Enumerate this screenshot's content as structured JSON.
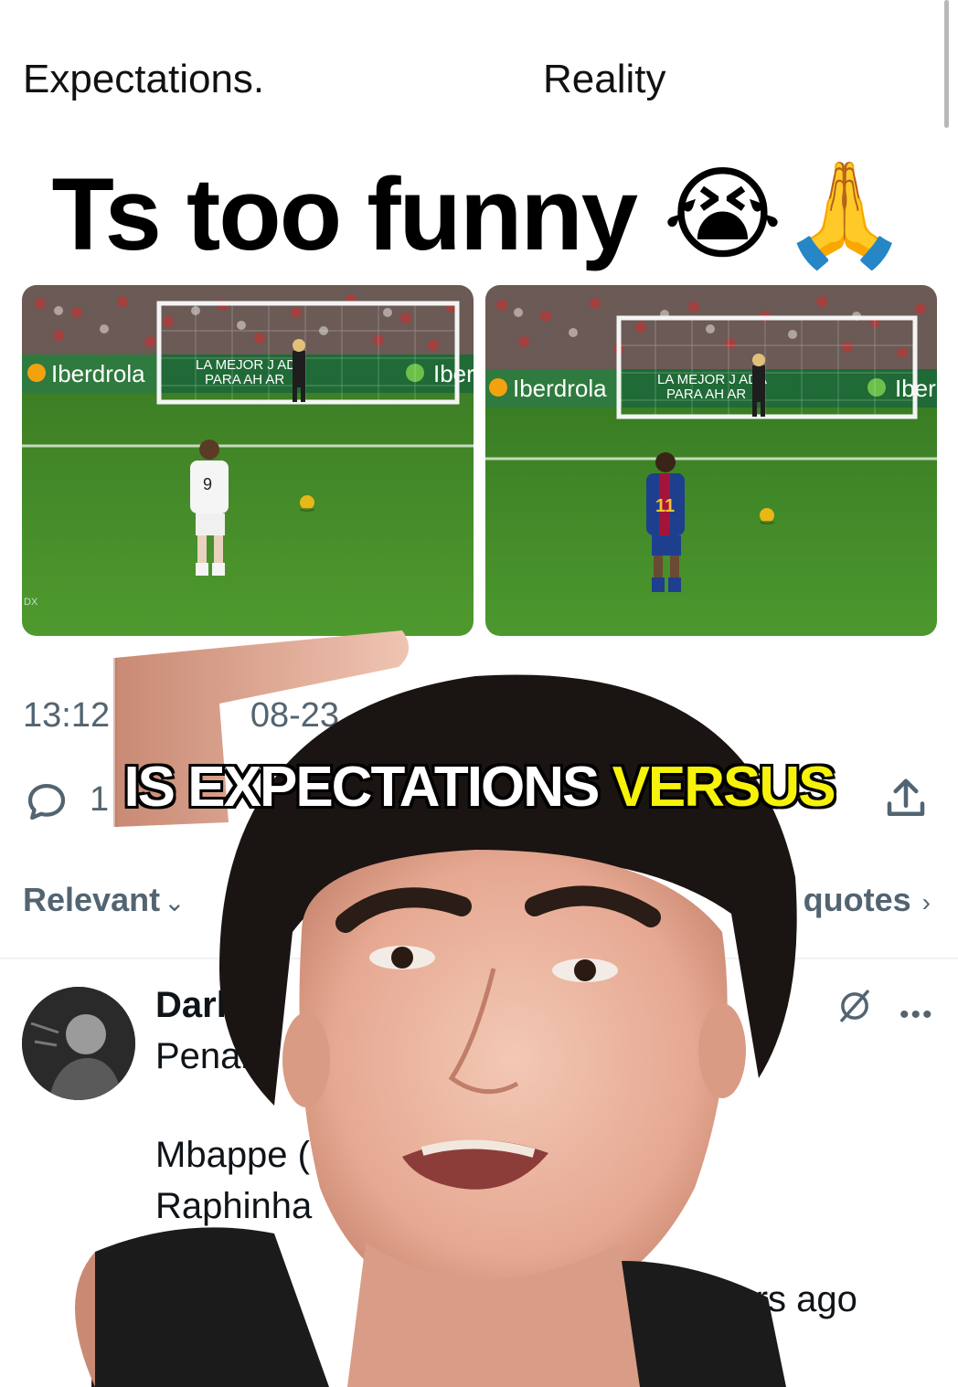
{
  "post": {
    "label_left": "Expectations.",
    "label_right": "Reality",
    "headline": "Ts too funny 😭🙏",
    "timestamp_visible": "13:12 ·",
    "date_fragment": "08-23",
    "reply_count_fragment": "1"
  },
  "media": {
    "left": {
      "board_left": "Iberdrola",
      "board_center_line1": "LA MEJOR J  ADA",
      "board_center_line2": "PARA AH   AR",
      "board_right": "Iber",
      "player_number": "9",
      "watermark": "DX"
    },
    "right": {
      "board_left": "Iberdrola",
      "board_center_line1": "LA MEJOR J  ADA",
      "board_center_line2": "PARA AH   AR",
      "board_right": "Iber",
      "player_number": "11"
    }
  },
  "sort": {
    "label": "Relevant",
    "quotes_label": "quotes"
  },
  "reply": {
    "name_fragment": "Dark C",
    "line1_fragment": "Penalty",
    "line2_fragment": "Mbappe (",
    "line3_fragment": "Raphinha",
    "age_fragment": "wo years ago"
  },
  "caption": {
    "white": "IS EXPECTATIONS",
    "yellow": "VERSUS"
  },
  "colors": {
    "caption_highlight": "#f7f20a",
    "secondary_text": "#536471",
    "pitch_green": "#3f8f2a"
  },
  "icons": [
    "reply-icon",
    "share-icon",
    "grok-icon",
    "more-icon",
    "chevron-down-icon",
    "chevron-right-icon"
  ]
}
